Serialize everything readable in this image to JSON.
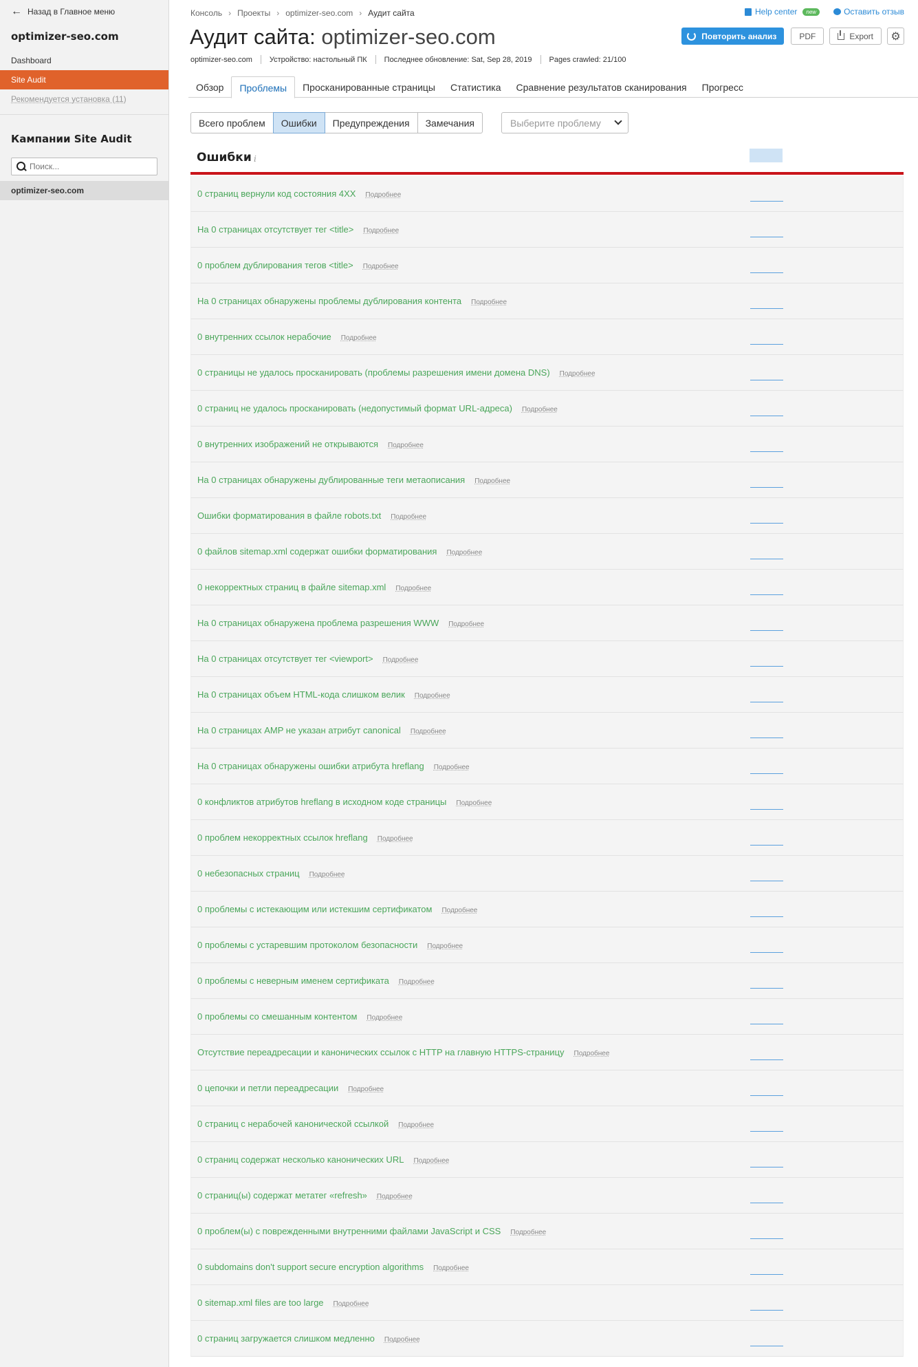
{
  "sidebar": {
    "back_label": "Назад в Главное меню",
    "project_title": "optimizer-seo.com",
    "items": [
      {
        "label": "Dashboard"
      },
      {
        "label": "Site Audit"
      },
      {
        "label": "Рекомендуется установка (11)"
      }
    ],
    "campaigns_title": "Кампании Site Audit",
    "search_placeholder": "Поиск...",
    "campaign_item": "optimizer-seo.com"
  },
  "header": {
    "breadcrumbs": [
      "Консоль",
      "Проекты",
      "optimizer-seo.com",
      "Аудит сайта"
    ],
    "help_center": "Help center",
    "new_badge": "new",
    "feedback": "Оставить отзыв",
    "title_prefix": "Аудит сайта:",
    "title_domain": "optimizer-seo.com",
    "rerun_label": "Повторить анализ",
    "pdf_label": "PDF",
    "export_label": "Export",
    "meta": {
      "domain": "optimizer-seo.com",
      "device": "Устройство: настольный ПК",
      "updated": "Последнее обновление: Sat, Sep 28, 2019",
      "crawled": "Pages crawled: 21/100"
    }
  },
  "tabs": [
    {
      "label": "Обзор"
    },
    {
      "label": "Проблемы"
    },
    {
      "label": "Просканированные страницы"
    },
    {
      "label": "Статистика"
    },
    {
      "label": "Сравнение результатов сканирования"
    },
    {
      "label": "Прогресс"
    }
  ],
  "filters": {
    "segments": [
      "Всего проблем",
      "Ошибки",
      "Предупреждения",
      "Замечания"
    ],
    "select_placeholder": "Выберите проблему"
  },
  "section": {
    "title": "Ошибки",
    "info": "i",
    "more_label": "Подробнее"
  },
  "issues": [
    "0 страниц вернули код состояния 4XX",
    "На 0 страницах отсутствует тег <title>",
    "0 проблем дублирования тегов <title>",
    "На 0 страницах обнаружены проблемы дублирования контента",
    "0 внутренних ссылок нерабочие",
    "0 страницы не удалось просканировать (проблемы разрешения имени домена DNS)",
    "0 страниц не удалось просканировать (недопустимый формат URL-адреса)",
    "0 внутренних изображений не открываются",
    "На 0 страницах обнаружены дублированные теги метаописания",
    "Ошибки форматирования в файле robots.txt",
    "0 файлов sitemap.xml содержат ошибки форматирования",
    "0 некорректных страниц в файле sitemap.xml",
    "На 0 страницах обнаружена проблема разрешения WWW",
    "На 0 страницах отсутствует тег <viewport>",
    "На 0 страницах объем HTML-кода слишком велик",
    "На 0 страницах AMP не указан атрибут canonical",
    "На 0 страницах обнаружены ошибки атрибута hreflang",
    "0 конфликтов атрибутов hreflang в исходном коде страницы",
    "0 проблем некорректных ссылок hreflang",
    "0 небезопасных страниц",
    "0 проблемы с истекающим или истекшим сертификатом",
    "0 проблемы с устаревшим протоколом безопасности",
    "0 проблемы с неверным именем сертификата",
    "0 проблемы со смешанным контентом",
    "Отсутствие переадресации и канонических ссылок с HTTP на главную HTTPS-страницу",
    "0 цепочки и петли переадресации",
    "0 страниц с нерабочей канонической ссылкой",
    "0 страниц содержат несколько канонических URL",
    "0 страниц(ы) содержат метатег «refresh»",
    "0 проблем(ы) с поврежденными внутренними файлами JavaScript и CSS",
    "0 subdomains don't support secure encryption algorithms",
    "0 sitemap.xml files are too large",
    "0 страниц загружается слишком медленно"
  ],
  "colors": {
    "accent": "#e0622b",
    "primary": "#2d92de",
    "issue_text": "#4aa65a",
    "error_rule": "#c9141a"
  }
}
